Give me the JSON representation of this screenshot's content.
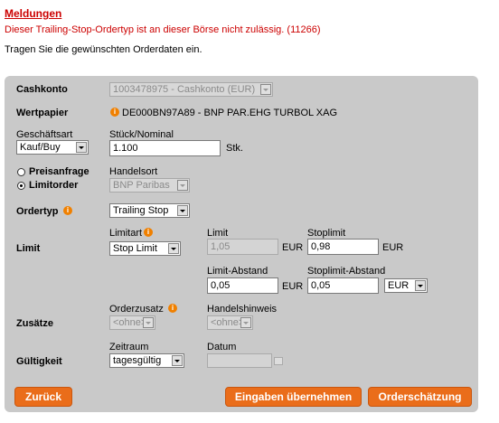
{
  "messages": {
    "title": "Meldungen",
    "error": "Dieser Trailing-Stop-Ordertyp ist an dieser Börse nicht zulässig.  (11266)",
    "instruction": "Tragen Sie die gewünschten Orderdaten ein."
  },
  "form": {
    "cashkonto_label": "Cashkonto",
    "cashkonto_value": "1003478975 - Cashkonto (EUR)",
    "wertpapier_label": "Wertpapier",
    "wertpapier_value": "DE000BN97A89 - BNP PAR.EHG TURBOL XAG",
    "geschaeftsart_label": "Geschäftsart",
    "geschaeftsart_value": "Kauf/Buy",
    "stueck_label": "Stück/Nominal",
    "stueck_value": "1.100",
    "stueck_unit": "Stk.",
    "preisanfrage_label": "Preisanfrage",
    "limitorder_label": "Limitorder",
    "handelsort_label": "Handelsort",
    "handelsort_value": "BNP Paribas",
    "ordertyp_label": "Ordertyp",
    "ordertyp_value": "Trailing Stop",
    "limit_section_label": "Limit",
    "limitart_label": "Limitart",
    "limitart_value": "Stop Limit",
    "limit_label": "Limit",
    "limit_value": "1,05",
    "limit_unit": "EUR",
    "stoplimit_label": "Stoplimit",
    "stoplimit_value": "0,98",
    "stoplimit_unit": "EUR",
    "limit_abstand_label": "Limit-Abstand",
    "limit_abstand_value": "0,05",
    "limit_abstand_unit": "EUR",
    "stoplimit_abstand_label": "Stoplimit-Abstand",
    "stoplimit_abstand_value": "0,05",
    "stoplimit_abstand_currency": "EUR",
    "zusaetze_label": "Zusätze",
    "orderzusatz_label": "Orderzusatz",
    "orderzusatz_value": "<ohne>",
    "handelshinweis_label": "Handelshinweis",
    "handelshinweis_value": "<ohne>",
    "gueltigkeit_label": "Gültigkeit",
    "zeitraum_label": "Zeitraum",
    "zeitraum_value": "tagesgültig",
    "datum_label": "Datum",
    "datum_value": ""
  },
  "buttons": {
    "back": "Zurück",
    "apply": "Eingaben übernehmen",
    "estimate": "Orderschätzung"
  },
  "colors": {
    "error_red": "#cc0000",
    "button_orange": "#ea6d1a",
    "panel_gray": "#c9c9c9"
  }
}
